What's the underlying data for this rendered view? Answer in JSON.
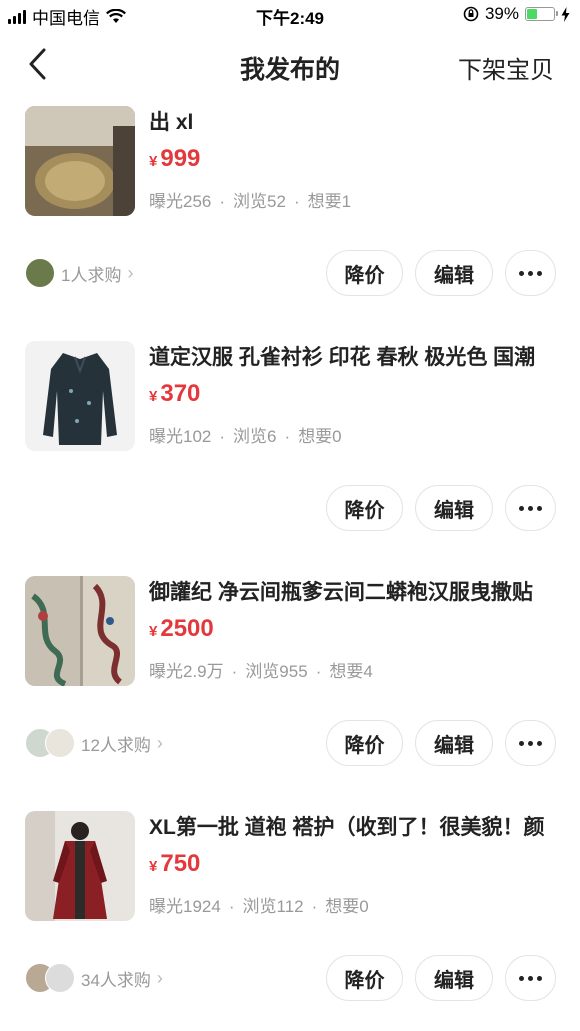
{
  "status_bar": {
    "carrier": "中国电信",
    "time": "下午2:49",
    "battery_percent": "39%",
    "battery_level": 0.39,
    "icons": [
      "signal-icon",
      "wifi-icon",
      "orientation-lock-icon",
      "battery-icon",
      "charging-icon"
    ]
  },
  "nav": {
    "title": "我发布的",
    "action_label": "下架宝贝",
    "back_icon": "chevron-left-icon"
  },
  "actions": {
    "price_cut_label": "降价",
    "edit_label": "编辑",
    "more_icon": "more-icon"
  },
  "currency_symbol": "¥",
  "stat_separator": "·",
  "items": [
    {
      "title": "出 xl",
      "price": "999",
      "exposure": "曝光256",
      "views": "浏览52",
      "wants": "想要1",
      "buyers": "1人求购"
    },
    {
      "title": "道定汉服 孔雀衬衫 印花 春秋 极光色 国潮",
      "price": "370",
      "exposure": "曝光102",
      "views": "浏览6",
      "wants": "想要0",
      "buyers": ""
    },
    {
      "title": "御讙纪 净云间瓶爹云间二蟒袍汉服曳撒贴",
      "price": "2500",
      "exposure": "曝光2.9万",
      "views": "浏览955",
      "wants": "想要4",
      "buyers": "12人求购"
    },
    {
      "title": "XL第一批 道袍 褡护（收到了！很美貌！颜",
      "price": "750",
      "exposure": "曝光1924",
      "views": "浏览112",
      "wants": "想要0",
      "buyers": "34人求购"
    }
  ],
  "colors": {
    "price": "#e4393c",
    "muted": "#999999",
    "button_border": "#e4e4e4",
    "battery_fill": "#4cd964"
  }
}
